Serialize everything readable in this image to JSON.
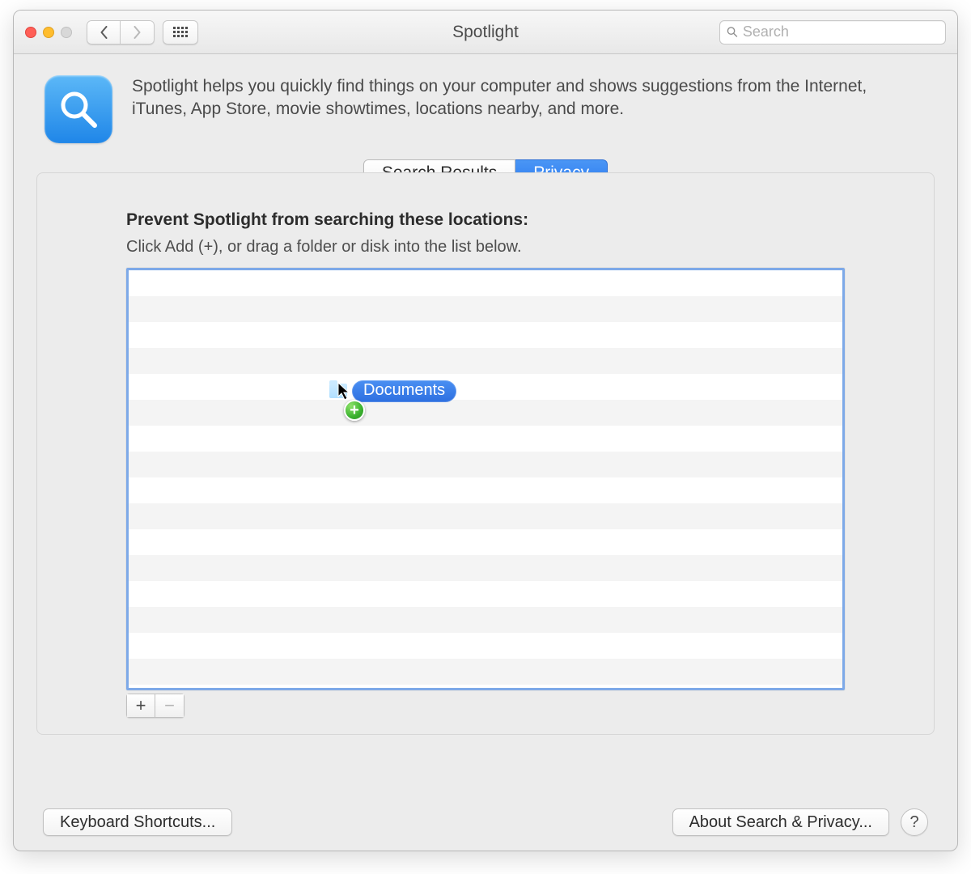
{
  "window": {
    "title": "Spotlight",
    "traffic": [
      "close",
      "minimize",
      "zoom-disabled"
    ]
  },
  "search": {
    "placeholder": "Search",
    "value": ""
  },
  "header": {
    "icon": "spotlight-icon",
    "description": "Spotlight helps you quickly find things on your computer and shows suggestions from the Internet, iTunes, App Store, movie showtimes, locations nearby, and more."
  },
  "tabs": {
    "items": [
      {
        "label": "Search Results",
        "active": false
      },
      {
        "label": "Privacy",
        "active": true
      }
    ]
  },
  "privacy_panel": {
    "title": "Prevent Spotlight from searching these locations:",
    "subtitle": "Click Add (+), or drag a folder or disk into the list below.",
    "listbox_rows": [],
    "drag_preview": {
      "item_label": "Documents",
      "badge": "plus-icon",
      "cursor": "arrow-cursor"
    },
    "add_label": "+",
    "remove_label": "−"
  },
  "footer": {
    "keyboard_shortcuts_label": "Keyboard Shortcuts...",
    "about_label": "About Search & Privacy...",
    "help_label": "?"
  }
}
